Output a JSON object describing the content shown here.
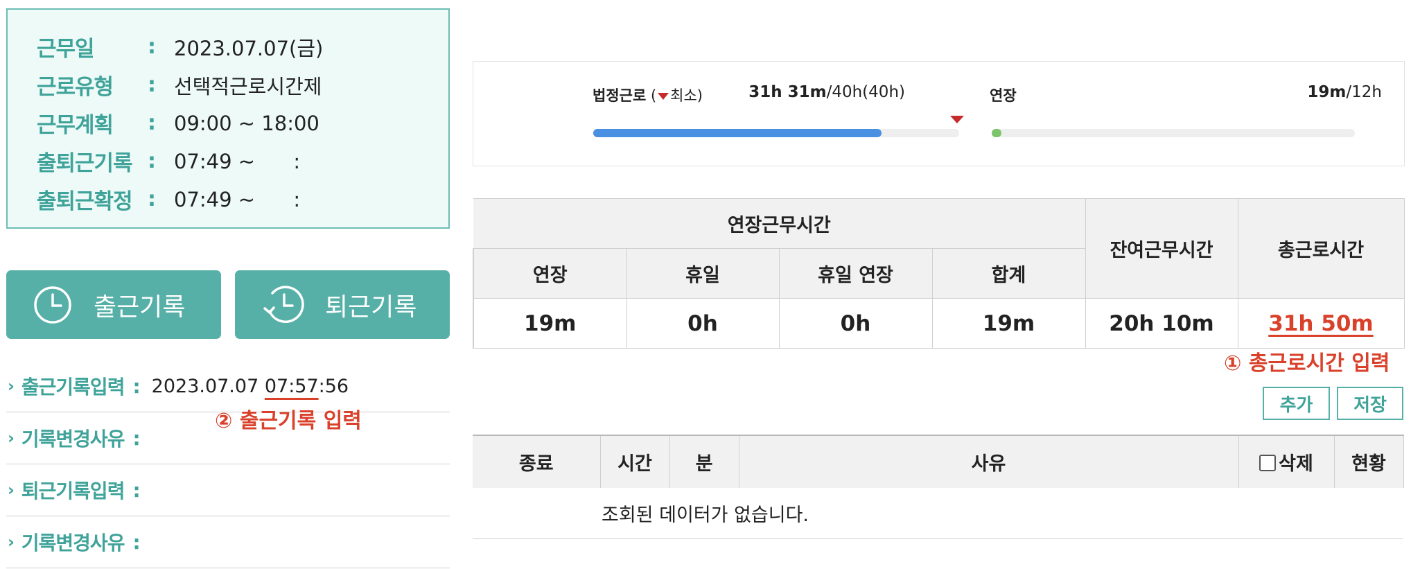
{
  "info": {
    "rows": [
      {
        "label": "근무일",
        "value": "2023.07.07(금)"
      },
      {
        "label": "근로유형",
        "value": "선택적근로시간제"
      },
      {
        "label": "근무계획",
        "value": "09:00 ~ 18:00"
      },
      {
        "label": "출퇴근기록",
        "value": "07:49 ~      :"
      },
      {
        "label": "출퇴근확정",
        "value": "07:49 ~      :"
      }
    ],
    "colon": ":"
  },
  "buttons": {
    "checkin": "출근기록",
    "checkout": "퇴근기록",
    "add": "추가",
    "save": "저장"
  },
  "records": {
    "arrow": "›",
    "colon": ":",
    "checkin_input_label": "출근기록입력",
    "checkin_date": "2023.07.07 ",
    "checkin_hm": "07:57",
    "checkin_sec": ":56",
    "change_reason_label_1": "기록변경사유",
    "checkout_input_label": "퇴근기록입력",
    "change_reason_label_2": "기록변경사유"
  },
  "annotations": {
    "a1": "① 총근로시간 입력",
    "a2": "② 출근기록 입력"
  },
  "progress": {
    "legal": {
      "label_bold": "법정근로",
      "label_open": " (",
      "label_min": "최소",
      "label_close": ")",
      "value_bold": "31h 31m",
      "value_rest": "/40h(",
      "value_pink": "40h",
      "value_end": ")",
      "fraction": 0.788
    },
    "overtime": {
      "label": "연장",
      "value_bold": "19m",
      "value_rest": "/12h",
      "fraction": 0.026
    },
    "colors": {
      "legal": "#4a90e2",
      "overtime": "#7cc46a",
      "marker": "#c62a2a"
    }
  },
  "summary": {
    "group_header": "연장근무시간",
    "sub_headers": [
      "연장",
      "휴일",
      "휴일 연장",
      "합계"
    ],
    "remaining_header": "잔여근무시간",
    "total_header": "총근로시간",
    "values": [
      "19m",
      "0h",
      "0h",
      "19m"
    ],
    "remaining_value": "20h 10m",
    "total_value": "31h 50m"
  },
  "list": {
    "headers": [
      "종료",
      "시간",
      "분",
      "사유",
      "삭제",
      "현황"
    ],
    "empty_message": "조회된 데이터가 없습니다."
  },
  "colors": {
    "teal": "#57b0a8",
    "teal_text": "#3fa39a",
    "annotation_red": "#d9412b"
  }
}
